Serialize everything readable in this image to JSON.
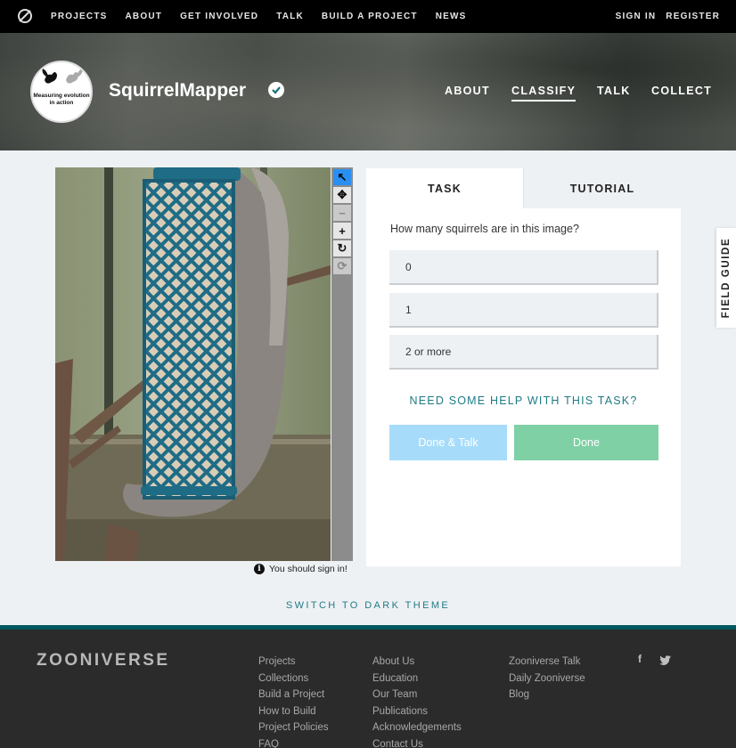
{
  "top_nav": {
    "links": [
      "PROJECTS",
      "ABOUT",
      "GET INVOLVED",
      "TALK",
      "BUILD A PROJECT",
      "NEWS"
    ],
    "sign_in": "SIGN IN",
    "register": "REGISTER"
  },
  "project": {
    "title": "SquirrelMapper",
    "avatar_text": "Measuring evolution in action",
    "nav": {
      "about": "ABOUT",
      "classify": "CLASSIFY",
      "talk": "TALK",
      "collect": "COLLECT"
    }
  },
  "viewer": {
    "sign_in_note": "You should sign in!"
  },
  "task_panel": {
    "tabs": {
      "task": "TASK",
      "tutorial": "TUTORIAL"
    },
    "question": "How many squirrels are in this image?",
    "answers": [
      "0",
      "1",
      "2 or more"
    ],
    "help_link": "NEED SOME HELP WITH THIS TASK?",
    "done_talk": "Done & Talk",
    "done": "Done"
  },
  "field_guide": "FIELD GUIDE",
  "dark_theme": "SWITCH TO DARK THEME",
  "footer": {
    "logo": "ZOONIVERSE",
    "col1": [
      "Projects",
      "Collections",
      "Build a Project",
      "How to Build",
      "Project Policies",
      "FAQ"
    ],
    "col2": [
      "About Us",
      "Education",
      "Our Team",
      "Publications",
      "Acknowledgements",
      "Contact Us"
    ],
    "col3": [
      "Zooniverse Talk",
      "Daily Zooniverse",
      "Blog"
    ],
    "social": [
      "facebook-icon",
      "twitter-icon"
    ]
  },
  "colors": {
    "accent_teal": "#1f7a85",
    "done_green": "#7fd0a5",
    "done_talk_blue": "#a6dcfa",
    "active_tool": "#2a8ff2",
    "footer_bg": "#2b2b2b"
  }
}
